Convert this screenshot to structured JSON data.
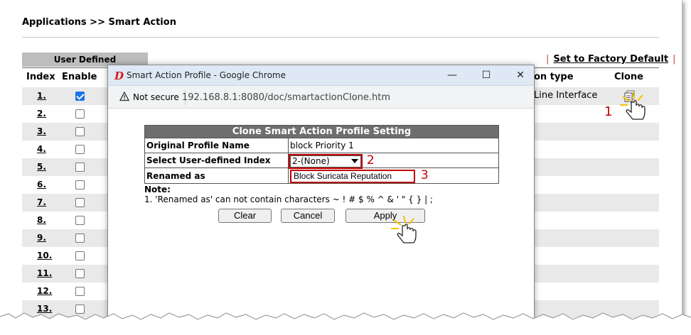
{
  "breadcrumb": "Applications >> Smart Action",
  "tabs": {
    "user_defined": "User Defined"
  },
  "links": {
    "separator": "|",
    "factory_default": "Set to Factory Default"
  },
  "table": {
    "headers": {
      "index": "Index",
      "enable": "Enable",
      "action_type": "on type",
      "clone": "Clone"
    },
    "rows": [
      {
        "index": "1.",
        "enabled": true,
        "action_type": "Line Interface"
      },
      {
        "index": "2.",
        "enabled": false
      },
      {
        "index": "3.",
        "enabled": false
      },
      {
        "index": "4.",
        "enabled": false
      },
      {
        "index": "5.",
        "enabled": false
      },
      {
        "index": "6.",
        "enabled": false
      },
      {
        "index": "7.",
        "enabled": false
      },
      {
        "index": "8.",
        "enabled": false
      },
      {
        "index": "9.",
        "enabled": false
      },
      {
        "index": "10.",
        "enabled": false
      },
      {
        "index": "11.",
        "enabled": false
      },
      {
        "index": "12.",
        "enabled": false
      },
      {
        "index": "13.",
        "enabled": false
      }
    ]
  },
  "popup": {
    "window_title": "Smart Action Profile - Google Chrome",
    "not_secure": "Not secure",
    "url": "192.168.8.1:8080/doc/smartactionClone.htm",
    "table_title": "Clone Smart Action Profile Setting",
    "original_profile_label": "Original Profile Name",
    "original_profile_value": "block Priority 1",
    "index_label": "Select User-defined Index",
    "index_value": "2-(None)",
    "rename_label": "Renamed as",
    "rename_value": "Block Suricata Reputation",
    "note_title": "Note:",
    "note_text": "1. 'Renamed as' can not contain characters ~ ! # $ % ^ & ' \" { } | ;",
    "buttons": {
      "clear": "Clear",
      "cancel": "Cancel",
      "apply": "Apply"
    }
  },
  "callouts": {
    "step1": "1",
    "step2": "2",
    "step3": "3"
  },
  "colors": {
    "callout": "#c00000",
    "checkbox_on": "#1a73e8",
    "table_header": "#6e6e6e",
    "titlebar": "#dfe9f5"
  }
}
